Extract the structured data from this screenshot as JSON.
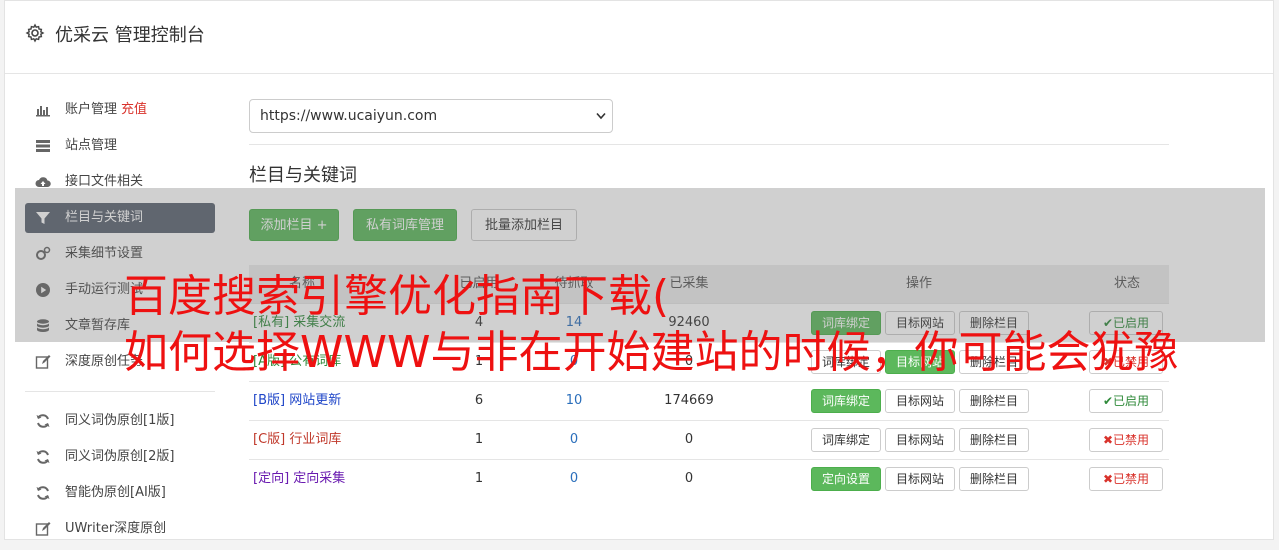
{
  "header": {
    "title": "优采云 管理控制台",
    "icon": "gear-icon"
  },
  "sidebar": {
    "items": [
      {
        "label": "账户管理",
        "badge": "充值",
        "icon": "bar-chart-icon"
      },
      {
        "label": "站点管理",
        "icon": "server-icon"
      },
      {
        "label": "接口文件相关",
        "icon": "cloud-upload-icon"
      },
      {
        "label": "栏目与关键词",
        "icon": "filter-icon",
        "active": true
      },
      {
        "label": "采集细节设置",
        "icon": "cogs-icon"
      },
      {
        "label": "手动运行测试",
        "icon": "play-circle-icon"
      },
      {
        "label": "文章暂存库",
        "icon": "database-icon"
      },
      {
        "label": "深度原创任务",
        "icon": "edit-icon"
      }
    ],
    "items2": [
      {
        "label": "同义词伪原创[1版]",
        "icon": "refresh-icon"
      },
      {
        "label": "同义词伪原创[2版]",
        "icon": "refresh-icon"
      },
      {
        "label": "智能伪原创[AI版]",
        "icon": "refresh-icon"
      },
      {
        "label": "UWriter深度原创",
        "icon": "edit-icon"
      }
    ]
  },
  "main": {
    "site_select": {
      "value": "https://www.ucaiyun.com"
    },
    "section_title": "栏目与关键词",
    "buttons": {
      "add_column": "添加栏目 +",
      "private_lib": "私有词库管理",
      "batch_add": "批量添加栏目"
    },
    "table": {
      "headers": {
        "name": "名称",
        "included": "已启用",
        "pending": "待抓取",
        "collected": "已采集",
        "ops": "操作",
        "status": "状态"
      },
      "rows": [
        {
          "tag": "[私有]",
          "name": "采集交流",
          "col1": "4",
          "col2": "14",
          "col3": "92460",
          "op1": "词库绑定",
          "op2": "目标网站",
          "op3": "删除栏目",
          "status": "已启用"
        },
        {
          "tag": "[A版]",
          "name": "公有词库",
          "col1": "1",
          "col2": "0",
          "col3": "0",
          "op1": "词库绑定",
          "op2": "目标网站",
          "op3": "删除栏目",
          "status": "已禁用"
        },
        {
          "tag": "[B版]",
          "name": "网站更新",
          "col1": "6",
          "col2": "10",
          "col3": "174669",
          "op1": "词库绑定",
          "op2": "目标网站",
          "op3": "删除栏目",
          "status": "已启用"
        },
        {
          "tag": "[C版]",
          "name": "行业词库",
          "col1": "1",
          "col2": "0",
          "col3": "0",
          "op1": "词库绑定",
          "op2": "目标网站",
          "op3": "删除栏目",
          "status": "已禁用"
        },
        {
          "tag": "[定向]",
          "name": "定向采集",
          "col1": "1",
          "col2": "0",
          "col3": "0",
          "op1": "定向设置",
          "op2": "目标网站",
          "op3": "删除栏目",
          "status": "已禁用"
        }
      ]
    }
  },
  "overlay": {
    "line1": "百度搜索引擎优化指南下载(",
    "line2": "如何选择WWW与非在开始建站的时候，你可能会犹豫"
  },
  "colors": {
    "green": "#5cb85c",
    "active_nav": "#5b6370",
    "red": "#d9322b"
  }
}
